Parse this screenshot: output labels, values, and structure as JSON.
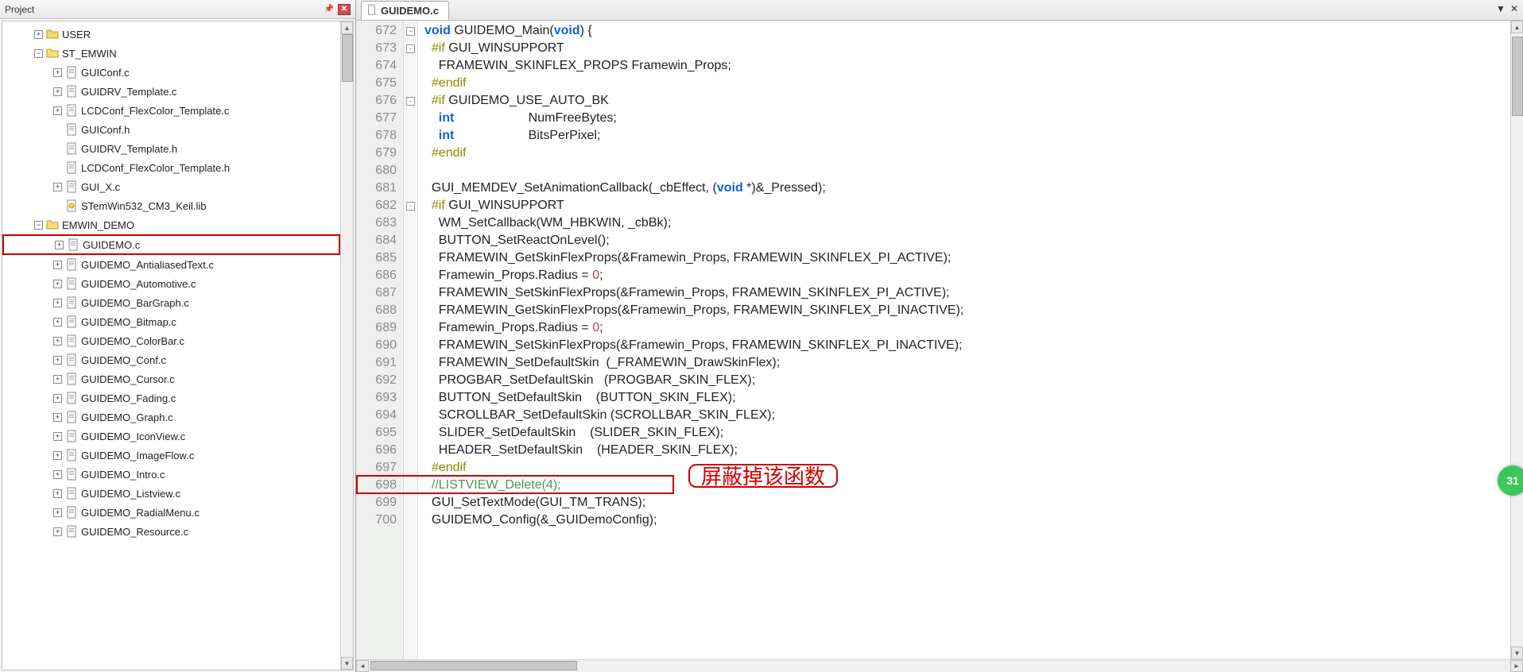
{
  "project_panel": {
    "title": "Project",
    "tree": {
      "folders": [
        {
          "name": "USER",
          "expanded": false,
          "indent": 1,
          "highlight": false,
          "files": []
        },
        {
          "name": "ST_EMWIN",
          "expanded": true,
          "indent": 1,
          "highlight": false,
          "files": [
            {
              "name": "GUIConf.c",
              "type": "c",
              "expandable": true
            },
            {
              "name": "GUIDRV_Template.c",
              "type": "c",
              "expandable": true
            },
            {
              "name": "LCDConf_FlexColor_Template.c",
              "type": "c",
              "expandable": true
            },
            {
              "name": "GUIConf.h",
              "type": "h",
              "expandable": false
            },
            {
              "name": "GUIDRV_Template.h",
              "type": "h",
              "expandable": false
            },
            {
              "name": "LCDConf_FlexColor_Template.h",
              "type": "h",
              "expandable": false
            },
            {
              "name": "GUI_X.c",
              "type": "c",
              "expandable": true
            },
            {
              "name": "STemWin532_CM3_Keil.lib",
              "type": "lib",
              "expandable": false
            }
          ]
        },
        {
          "name": "EMWIN_DEMO",
          "expanded": true,
          "indent": 1,
          "highlight": false,
          "files": [
            {
              "name": "GUIDEMO.c",
              "type": "c",
              "expandable": true,
              "highlight": true
            },
            {
              "name": "GUIDEMO_AntialiasedText.c",
              "type": "c",
              "expandable": true
            },
            {
              "name": "GUIDEMO_Automotive.c",
              "type": "c",
              "expandable": true
            },
            {
              "name": "GUIDEMO_BarGraph.c",
              "type": "c",
              "expandable": true
            },
            {
              "name": "GUIDEMO_Bitmap.c",
              "type": "c",
              "expandable": true
            },
            {
              "name": "GUIDEMO_ColorBar.c",
              "type": "c",
              "expandable": true
            },
            {
              "name": "GUIDEMO_Conf.c",
              "type": "c",
              "expandable": true
            },
            {
              "name": "GUIDEMO_Cursor.c",
              "type": "c",
              "expandable": true
            },
            {
              "name": "GUIDEMO_Fading.c",
              "type": "c",
              "expandable": true
            },
            {
              "name": "GUIDEMO_Graph.c",
              "type": "c",
              "expandable": true
            },
            {
              "name": "GUIDEMO_IconView.c",
              "type": "c",
              "expandable": true
            },
            {
              "name": "GUIDEMO_ImageFlow.c",
              "type": "c",
              "expandable": true
            },
            {
              "name": "GUIDEMO_Intro.c",
              "type": "c",
              "expandable": true
            },
            {
              "name": "GUIDEMO_Listview.c",
              "type": "c",
              "expandable": true
            },
            {
              "name": "GUIDEMO_RadialMenu.c",
              "type": "c",
              "expandable": true
            },
            {
              "name": "GUIDEMO_Resource.c",
              "type": "c",
              "expandable": true
            }
          ]
        }
      ]
    }
  },
  "editor": {
    "tab_label": "GUIDEMO.c",
    "first_line": 672,
    "lines": [
      {
        "n": 672,
        "fold": "-",
        "html": "<span class='kw'>void</span> GUIDEMO_Main(<span class='kw'>void</span>) {"
      },
      {
        "n": 673,
        "fold": "-",
        "html": "  <span class='pp'>#if</span> GUI_WINSUPPORT"
      },
      {
        "n": 674,
        "fold": "",
        "html": "    FRAMEWIN_SKINFLEX_PROPS Framewin_Props;"
      },
      {
        "n": 675,
        "fold": "",
        "html": "  <span class='pp'>#endif</span>"
      },
      {
        "n": 676,
        "fold": "-",
        "html": "  <span class='pp'>#if</span> GUIDEMO_USE_AUTO_BK"
      },
      {
        "n": 677,
        "fold": "",
        "html": "    <span class='kw'>int</span>                     NumFreeBytes;"
      },
      {
        "n": 678,
        "fold": "",
        "html": "    <span class='kw'>int</span>                     BitsPerPixel;"
      },
      {
        "n": 679,
        "fold": "",
        "html": "  <span class='pp'>#endif</span>"
      },
      {
        "n": 680,
        "fold": "",
        "html": ""
      },
      {
        "n": 681,
        "fold": "",
        "html": "  GUI_MEMDEV_SetAnimationCallback(_cbEffect, (<span class='kw'>void</span> *)&amp;_Pressed);"
      },
      {
        "n": 682,
        "fold": "-",
        "html": "  <span class='pp'>#if</span> GUI_WINSUPPORT"
      },
      {
        "n": 683,
        "fold": "",
        "html": "    WM_SetCallback(WM_HBKWIN, _cbBk);"
      },
      {
        "n": 684,
        "fold": "",
        "html": "    BUTTON_SetReactOnLevel();"
      },
      {
        "n": 685,
        "fold": "",
        "html": "    FRAMEWIN_GetSkinFlexProps(&amp;Framewin_Props, FRAMEWIN_SKINFLEX_PI_ACTIVE);"
      },
      {
        "n": 686,
        "fold": "",
        "html": "    Framewin_Props.Radius = <span class='num'>0</span>;"
      },
      {
        "n": 687,
        "fold": "",
        "html": "    FRAMEWIN_SetSkinFlexProps(&amp;Framewin_Props, FRAMEWIN_SKINFLEX_PI_ACTIVE);"
      },
      {
        "n": 688,
        "fold": "",
        "html": "    FRAMEWIN_GetSkinFlexProps(&amp;Framewin_Props, FRAMEWIN_SKINFLEX_PI_INACTIVE);"
      },
      {
        "n": 689,
        "fold": "",
        "html": "    Framewin_Props.Radius = <span class='num'>0</span>;"
      },
      {
        "n": 690,
        "fold": "",
        "html": "    FRAMEWIN_SetSkinFlexProps(&amp;Framewin_Props, FRAMEWIN_SKINFLEX_PI_INACTIVE);"
      },
      {
        "n": 691,
        "fold": "",
        "html": "    FRAMEWIN_SetDefaultSkin  (_FRAMEWIN_DrawSkinFlex);"
      },
      {
        "n": 692,
        "fold": "",
        "html": "    PROGBAR_SetDefaultSkin   (PROGBAR_SKIN_FLEX);"
      },
      {
        "n": 693,
        "fold": "",
        "html": "    BUTTON_SetDefaultSkin    (BUTTON_SKIN_FLEX);"
      },
      {
        "n": 694,
        "fold": "",
        "html": "    SCROLLBAR_SetDefaultSkin (SCROLLBAR_SKIN_FLEX);"
      },
      {
        "n": 695,
        "fold": "",
        "html": "    SLIDER_SetDefaultSkin    (SLIDER_SKIN_FLEX);"
      },
      {
        "n": 696,
        "fold": "",
        "html": "    HEADER_SetDefaultSkin    (HEADER_SKIN_FLEX);"
      },
      {
        "n": 697,
        "fold": "",
        "html": "  <span class='pp'>#endif</span>"
      },
      {
        "n": 698,
        "fold": "",
        "html": "  <span class='cmt'>//LISTVIEW_Delete(4);</span>",
        "boxed": true
      },
      {
        "n": 699,
        "fold": "",
        "html": "  GUI_SetTextMode(GUI_TM_TRANS);"
      },
      {
        "n": 700,
        "fold": "",
        "html": "  GUIDEMO_Config(&amp;_GUIDemoConfig);"
      }
    ],
    "annotation_text": "屏蔽掉该函数",
    "badge_text": "31"
  }
}
